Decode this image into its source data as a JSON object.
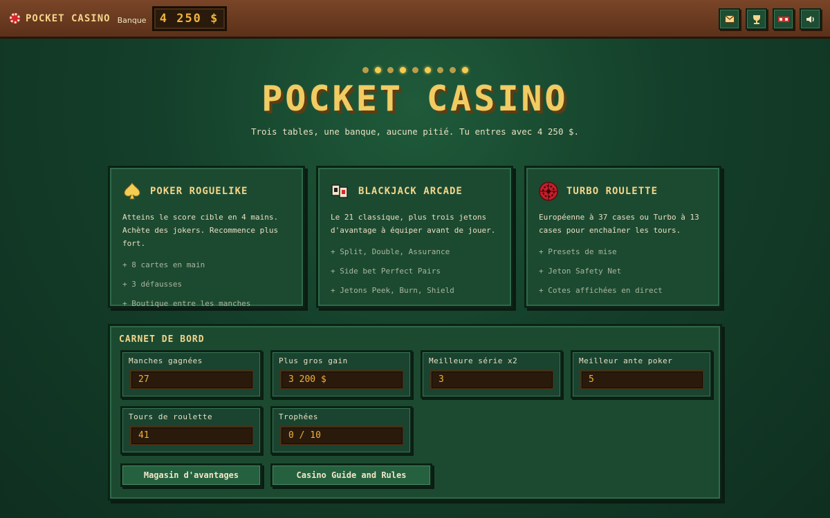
{
  "app": {
    "title": "POCKET CASINO",
    "bank_label": "Banque",
    "bank_value": "4 250 $"
  },
  "top_actions": [
    {
      "icon": "mail-icon",
      "glyph": "✉"
    },
    {
      "icon": "trophy-icon",
      "glyph": "🏆"
    },
    {
      "icon": "ticket-icon",
      "glyph": "▮"
    },
    {
      "icon": "speaker-icon",
      "glyph": "🔈"
    }
  ],
  "hero": {
    "title": "POCKET CASINO",
    "subtitle": "Trois tables, une banque, aucune pitié. Tu entres avec 4 250 $."
  },
  "games": [
    {
      "icon": "spade-icon",
      "title": "POKER ROGUELIKE",
      "description": "Atteins le score cible en 4 mains. Achète des jokers. Recommence plus fort.",
      "features": [
        "+ 8 cartes en main",
        "+ 3 défausses",
        "+ Boutique entre les manches"
      ]
    },
    {
      "icon": "cards-icon",
      "title": "BLACKJACK ARCADE",
      "description": "Le 21 classique, plus trois jetons d'avantage à équiper avant de jouer.",
      "features": [
        "+ Split, Double, Assurance",
        "+ Side bet Perfect Pairs",
        "+ Jetons Peek, Burn, Shield"
      ]
    },
    {
      "icon": "roulette-icon",
      "title": "TURBO ROULETTE",
      "description": "Européenne à 37 cases ou Turbo à 13 cases pour enchaîner les tours.",
      "features": [
        "+ Presets de mise",
        "+ Jeton Safety Net",
        "+ Cotes affichées en direct"
      ]
    }
  ],
  "carnet": {
    "title": "CARNET DE BORD",
    "stats": [
      {
        "label": "Manches gagnées",
        "value": "27"
      },
      {
        "label": "Plus gros gain",
        "value": "3 200 $"
      },
      {
        "label": "Meilleure série x2",
        "value": "3"
      },
      {
        "label": "Meilleur ante poker",
        "value": "5"
      },
      {
        "label": "Tours de roulette",
        "value": "41"
      },
      {
        "label": "Trophées",
        "value": "0 / 10"
      }
    ],
    "buttons": [
      {
        "label": "Magasin d'avantages"
      },
      {
        "label": "Casino Guide and Rules"
      }
    ]
  },
  "colors": {
    "felt": "#1c4a31",
    "gold": "#f4d58a",
    "amber": "#f0b33c",
    "wood": "#6a3a20"
  }
}
